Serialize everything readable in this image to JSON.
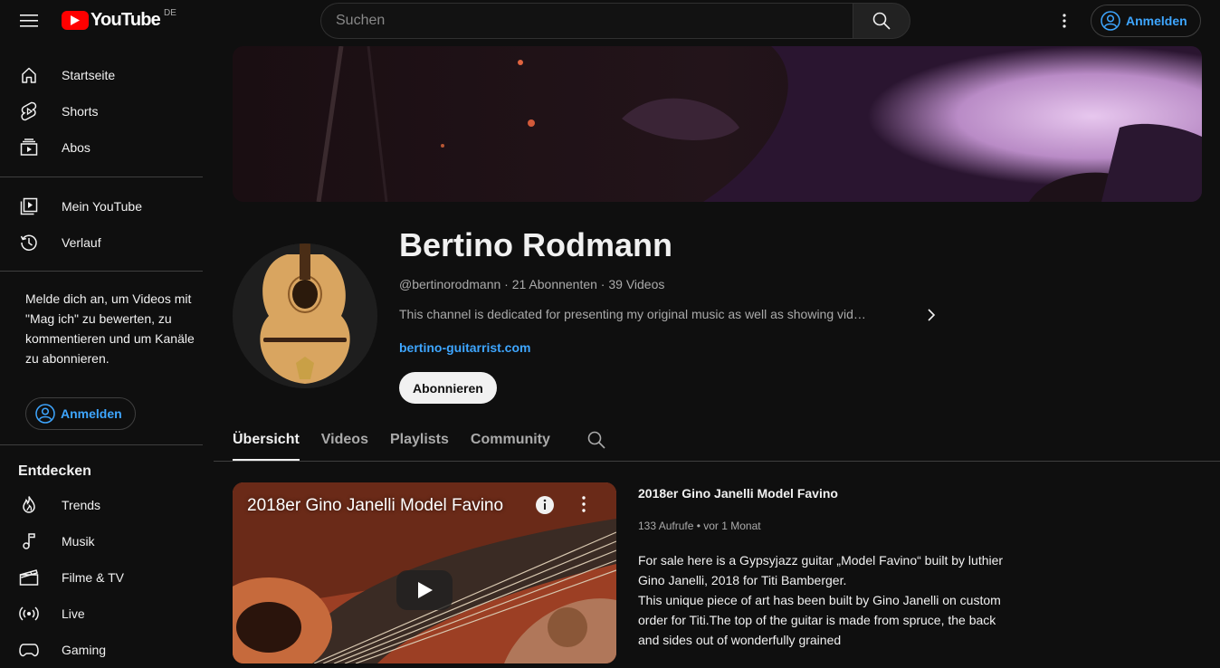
{
  "header": {
    "logo_text": "YouTube",
    "country": "DE",
    "search_placeholder": "Suchen",
    "signin_label": "Anmelden"
  },
  "sidebar": {
    "main": [
      {
        "label": "Startseite",
        "icon": "home-icon"
      },
      {
        "label": "Shorts",
        "icon": "shorts-icon"
      },
      {
        "label": "Abos",
        "icon": "subscriptions-icon"
      }
    ],
    "you": [
      {
        "label": "Mein YouTube",
        "icon": "library-icon"
      },
      {
        "label": "Verlauf",
        "icon": "history-icon"
      }
    ],
    "signin_message": "Melde dich an, um Videos mit \"Mag ich\" zu bewerten, zu kommentieren und um Kanäle zu abonnieren.",
    "signin_label": "Anmelden",
    "explore_title": "Entdecken",
    "explore": [
      {
        "label": "Trends",
        "icon": "trending-icon"
      },
      {
        "label": "Musik",
        "icon": "music-icon"
      },
      {
        "label": "Filme & TV",
        "icon": "movies-icon"
      },
      {
        "label": "Live",
        "icon": "live-icon"
      },
      {
        "label": "Gaming",
        "icon": "gaming-icon"
      }
    ]
  },
  "channel": {
    "name": "Bertino Rodmann",
    "meta": "@bertinorodmann · 21 Abonnenten · 39 Videos",
    "description": "This channel is dedicated for presenting my original music as well as showing vid…",
    "link": "bertino-guitarrist.com",
    "subscribe_label": "Abonnieren"
  },
  "tabs": [
    "Übersicht",
    "Videos",
    "Playlists",
    "Community"
  ],
  "featured_video": {
    "overlay_title": "2018er Gino Janelli Model Favino",
    "title": "2018er Gino Janelli Model Favino",
    "meta": "133 Aufrufe • vor 1 Monat",
    "description": "For sale here is a Gypsyjazz guitar „Model Favino“ built by luthier Gino Janelli, 2018 for Titi Bamberger.\nThis unique piece of art has been built by Gino Janelli on custom order for Titi.The top of the guitar is made from spruce, the back and sides out of wonderfully grained"
  },
  "colors": {
    "background": "#0f0f0f",
    "accent_link": "#3ea6ff",
    "logo_red": "#ff0000"
  }
}
